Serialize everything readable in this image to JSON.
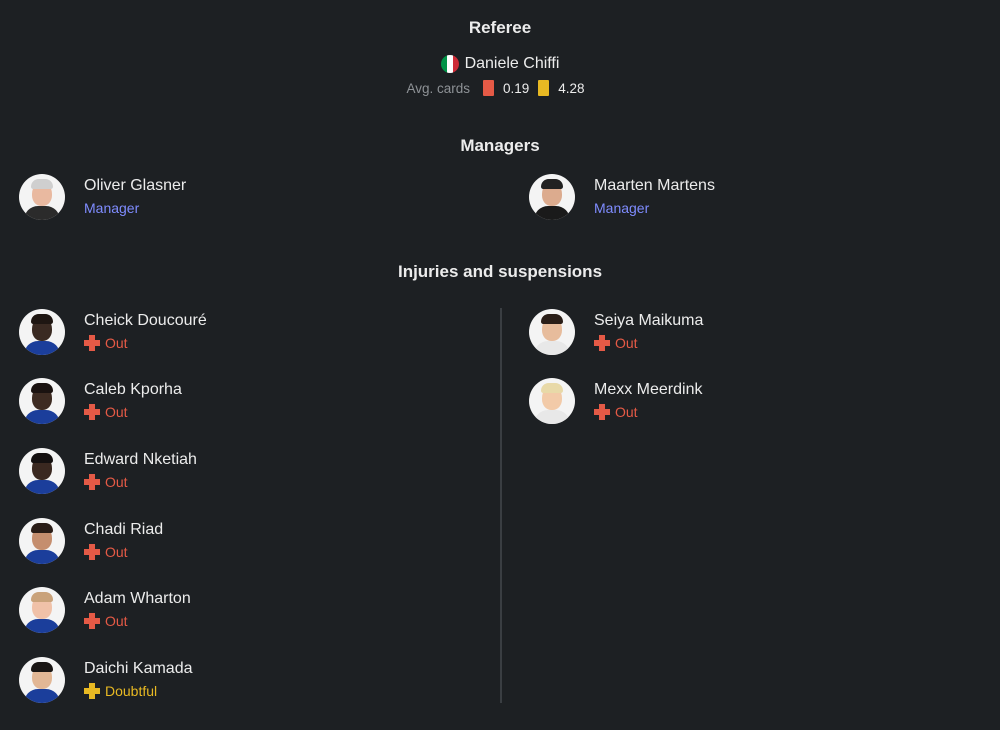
{
  "referee": {
    "title": "Referee",
    "name": "Daniele Chiffi",
    "flag_colors": [
      "#009246",
      "#ffffff",
      "#ce2b37"
    ],
    "avg_cards_label": "Avg. cards",
    "red_cards_avg": "0.19",
    "yellow_cards_avg": "4.28",
    "red_color": "#e55a46",
    "yellow_color": "#e8b923"
  },
  "managers": {
    "title": "Managers",
    "home": {
      "name": "Oliver Glasner",
      "role": "Manager"
    },
    "away": {
      "name": "Maarten Martens",
      "role": "Manager"
    }
  },
  "injuries": {
    "title": "Injuries and suspensions",
    "home": [
      {
        "name": "Cheick Doucouré",
        "status": "Out",
        "status_type": "out"
      },
      {
        "name": "Caleb Kporha",
        "status": "Out",
        "status_type": "out"
      },
      {
        "name": "Edward Nketiah",
        "status": "Out",
        "status_type": "out"
      },
      {
        "name": "Chadi Riad",
        "status": "Out",
        "status_type": "out"
      },
      {
        "name": "Adam Wharton",
        "status": "Out",
        "status_type": "out"
      },
      {
        "name": "Daichi Kamada",
        "status": "Doubtful",
        "status_type": "doubtful"
      }
    ],
    "away": [
      {
        "name": "Seiya Maikuma",
        "status": "Out",
        "status_type": "out"
      },
      {
        "name": "Mexx Meerdink",
        "status": "Out",
        "status_type": "out"
      }
    ]
  }
}
